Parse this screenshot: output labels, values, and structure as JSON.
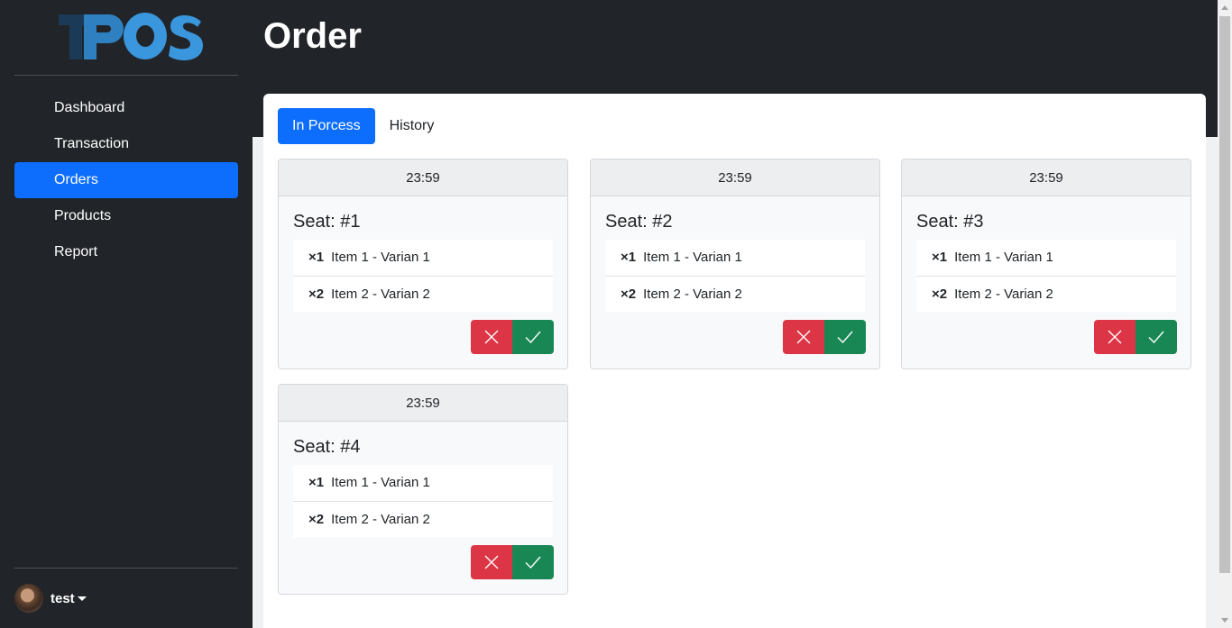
{
  "app": {
    "logo_text": "TPOS"
  },
  "sidebar": {
    "items": [
      {
        "label": "Dashboard",
        "active": false
      },
      {
        "label": "Transaction",
        "active": false
      },
      {
        "label": "Orders",
        "active": true
      },
      {
        "label": "Products",
        "active": false
      },
      {
        "label": "Report",
        "active": false
      }
    ],
    "user": {
      "name": "test"
    }
  },
  "header": {
    "title": "Order"
  },
  "tabs": [
    {
      "label": "In Porcess",
      "active": true
    },
    {
      "label": "History",
      "active": false
    }
  ],
  "orders": [
    {
      "time": "23:59",
      "seat": "Seat: #1",
      "items": [
        {
          "qty": "×1",
          "name": "Item 1 - Varian 1"
        },
        {
          "qty": "×2",
          "name": "Item 2 - Varian 2"
        }
      ]
    },
    {
      "time": "23:59",
      "seat": "Seat: #2",
      "items": [
        {
          "qty": "×1",
          "name": "Item 1 - Varian 1"
        },
        {
          "qty": "×2",
          "name": "Item 2 - Varian 2"
        }
      ]
    },
    {
      "time": "23:59",
      "seat": "Seat: #3",
      "items": [
        {
          "qty": "×1",
          "name": "Item 1 - Varian 1"
        },
        {
          "qty": "×2",
          "name": "Item 2 - Varian 2"
        }
      ]
    },
    {
      "time": "23:59",
      "seat": "Seat: #4",
      "items": [
        {
          "qty": "×1",
          "name": "Item 1 - Varian 1"
        },
        {
          "qty": "×2",
          "name": "Item 2 - Varian 2"
        }
      ]
    }
  ],
  "icons": {
    "reject": "close-icon",
    "accept": "check-icon"
  },
  "colors": {
    "primary": "#0d6efd",
    "danger": "#dc3545",
    "success": "#198754",
    "dark": "#212529",
    "logo_dark": "#1b3a57",
    "logo_light": "#3a96dd"
  }
}
